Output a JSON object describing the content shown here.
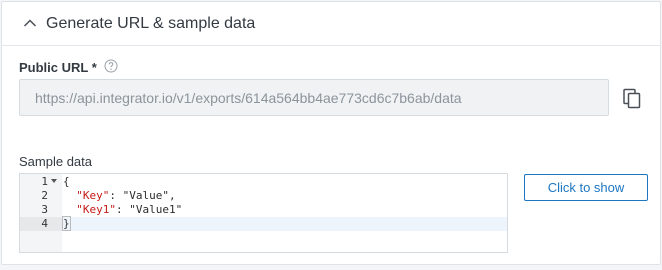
{
  "section": {
    "title": "Generate URL & sample data",
    "collapse_icon": "chevron-up-icon"
  },
  "public_url": {
    "label": "Public URL *",
    "help_icon": "help-circle-icon",
    "value": "https://api.integrator.io/v1/exports/614a564bb4ae773cd6c7b6ab/data",
    "copy_icon": "copy-icon"
  },
  "sample_data": {
    "label": "Sample data",
    "line_numbers": [
      "1",
      "2",
      "3",
      "4"
    ],
    "lines": {
      "l1": "{",
      "l2_key": "\"Key\"",
      "l2_sep": ": ",
      "l2_val": "\"Value\"",
      "l2_end": ",",
      "l3_key": "\"Key1\"",
      "l3_sep": ": ",
      "l3_val": "\"Value1\"",
      "l4": "}"
    },
    "show_button": "Click to show"
  },
  "colors": {
    "accent": "#1d76c2",
    "json_key": "#c41a16",
    "border": "#d6dbe0"
  }
}
